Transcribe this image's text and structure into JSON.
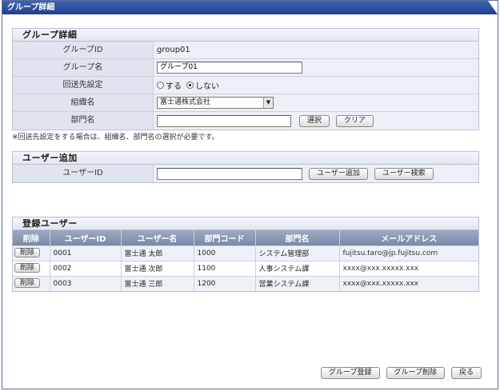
{
  "window": {
    "title": "グループ詳細"
  },
  "group_detail": {
    "heading": "グループ詳細",
    "fields": {
      "group_id": {
        "label": "グループID",
        "value": "group01"
      },
      "group_name": {
        "label": "グループ名",
        "value": "グループ01"
      },
      "reply_setting": {
        "label": "回送先設定",
        "option_yes": "する",
        "option_no": "しない",
        "selected": "しない"
      },
      "org_name": {
        "label": "組織名",
        "value": "富士通株式会社"
      },
      "dept_name": {
        "label": "部門名",
        "value": "",
        "select_button": "選択",
        "clear_button": "クリア"
      }
    },
    "note": "※回送先設定をする場合は、組織名、部門名の選択が必要です。"
  },
  "user_add": {
    "heading": "ユーザー追加",
    "user_id_label": "ユーザーID",
    "user_id_value": "",
    "add_button": "ユーザー追加",
    "search_button": "ユーザー検索"
  },
  "registered_users": {
    "heading": "登録ユーザー",
    "columns": [
      "削除",
      "ユーザーID",
      "ユーザー名",
      "部門コード",
      "部門名",
      "メールアドレス"
    ],
    "delete_label": "削除",
    "rows": [
      {
        "user_id": "0001",
        "user_name": "富士通 太郎",
        "dept_code": "1000",
        "dept_name": "システム管理部",
        "email": "fujitsu.taro@jp.fujitsu.com"
      },
      {
        "user_id": "0002",
        "user_name": "富士通 次郎",
        "dept_code": "1100",
        "dept_name": "人事システム課",
        "email": "xxxx@xxx.xxxxx.xxx"
      },
      {
        "user_id": "0003",
        "user_name": "富士通 三郎",
        "dept_code": "1200",
        "dept_name": "営業システム課",
        "email": "xxxx@xxx.xxxxx.xxx"
      }
    ]
  },
  "footer": {
    "register_button": "グループ登録",
    "delete_button": "グループ削除",
    "back_button": "戻る"
  },
  "colors": {
    "titlebar": "#2a4c9e",
    "header_row": "#8693b0",
    "label_cell": "#dfe4ef"
  },
  "icons": {
    "dropdown": "chevron-down-icon",
    "radio": "radio-icon"
  }
}
